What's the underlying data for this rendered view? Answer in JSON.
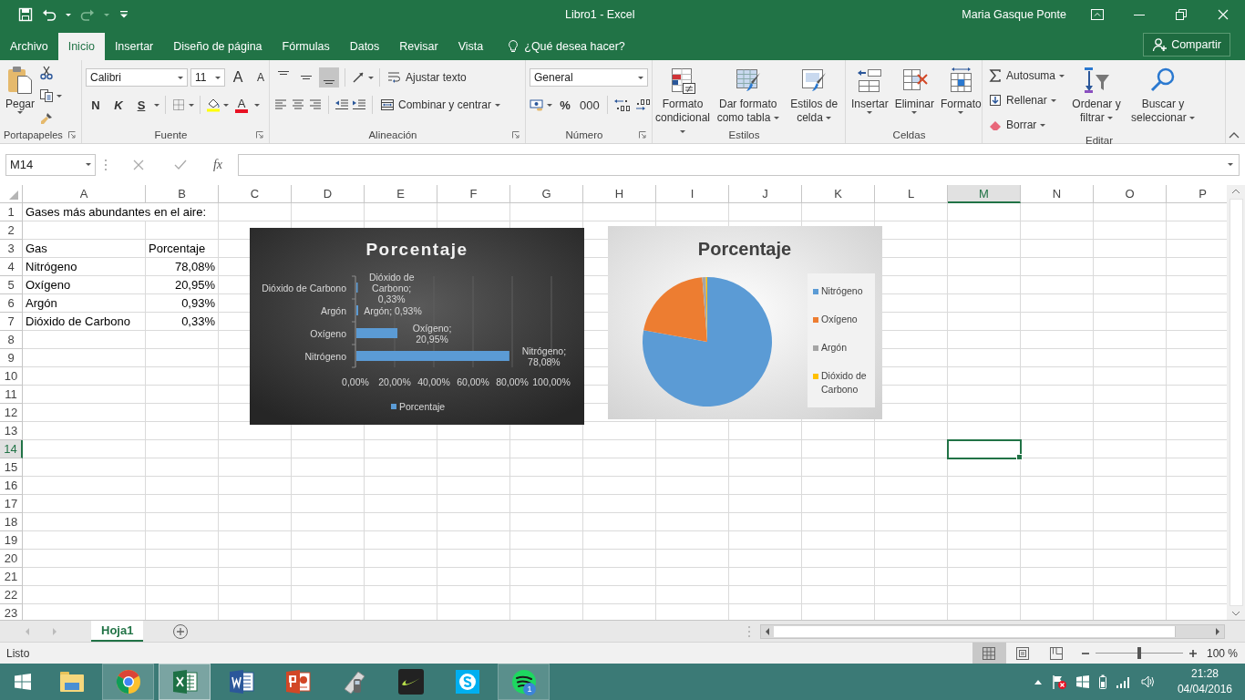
{
  "window": {
    "title": "Libro1 - Excel",
    "user": "Maria Gasque Ponte"
  },
  "tabs": [
    {
      "label": "Archivo",
      "selected": false
    },
    {
      "label": "Inicio",
      "selected": true
    },
    {
      "label": "Insertar",
      "selected": false
    },
    {
      "label": "Diseño de página",
      "selected": false
    },
    {
      "label": "Fórmulas",
      "selected": false
    },
    {
      "label": "Datos",
      "selected": false
    },
    {
      "label": "Revisar",
      "selected": false
    },
    {
      "label": "Vista",
      "selected": false
    }
  ],
  "tell_me": "¿Qué desea hacer?",
  "share": "Compartir",
  "ribbon": {
    "clipboard": {
      "label": "Portapapeles",
      "paste": "Pegar"
    },
    "font": {
      "label": "Fuente",
      "font_name": "Calibri",
      "font_size": "11",
      "grow": "A",
      "shrink": "A",
      "bold": "N",
      "italic": "K",
      "underline": "S",
      "font_color": "A"
    },
    "alignment": {
      "label": "Alineación",
      "vertical": [
        {
          "selected": false
        },
        {
          "selected": false
        },
        {
          "selected": true
        }
      ],
      "wrap": "Ajustar texto",
      "merge": "Combinar y centrar"
    },
    "number": {
      "label": "Número",
      "format": "General",
      "percent": "%",
      "thousands": "000"
    },
    "styles": {
      "label": "Estilos",
      "buttons": [
        "Formato condicional",
        "Dar formato como tabla",
        "Estilos de celda"
      ]
    },
    "cells": {
      "label": "Celdas",
      "buttons": [
        "Insertar",
        "Eliminar",
        "Formato"
      ]
    },
    "editing": {
      "label": "Editar",
      "commands": [
        "Autosuma",
        "Rellenar",
        "Borrar"
      ],
      "buttons": [
        "Ordenar y filtrar",
        "Buscar y seleccionar"
      ]
    }
  },
  "formula_bar": {
    "name_box": "M14",
    "function_label": "fx"
  },
  "sheet": {
    "columns": [
      {
        "label": "A",
        "selected": false
      },
      {
        "label": "B",
        "selected": false
      },
      {
        "label": "C",
        "selected": false
      },
      {
        "label": "D",
        "selected": false
      },
      {
        "label": "E",
        "selected": false
      },
      {
        "label": "F",
        "selected": false
      },
      {
        "label": "G",
        "selected": false
      },
      {
        "label": "H",
        "selected": false
      },
      {
        "label": "I",
        "selected": false
      },
      {
        "label": "J",
        "selected": false
      },
      {
        "label": "K",
        "selected": false
      },
      {
        "label": "L",
        "selected": false
      },
      {
        "label": "M",
        "selected": true
      },
      {
        "label": "N",
        "selected": false
      },
      {
        "label": "O",
        "selected": false
      },
      {
        "label": "P",
        "selected": false
      }
    ],
    "rows": [
      {
        "label": "1",
        "selected": false,
        "cells": {
          "A": {
            "text": "Gases más abundantes en el aire:"
          }
        }
      },
      {
        "label": "2",
        "selected": false
      },
      {
        "label": "3",
        "selected": false,
        "cells": {
          "A": {
            "text": "Gas"
          },
          "B": {
            "text": "Porcentaje"
          }
        }
      },
      {
        "label": "4",
        "selected": false,
        "cells": {
          "A": {
            "text": "Nitrógeno"
          },
          "B": {
            "text": "78,08%",
            "kind": "number"
          }
        }
      },
      {
        "label": "5",
        "selected": false,
        "cells": {
          "A": {
            "text": "Oxígeno"
          },
          "B": {
            "text": "20,95%",
            "kind": "number"
          }
        }
      },
      {
        "label": "6",
        "selected": false,
        "cells": {
          "A": {
            "text": "Argón"
          },
          "B": {
            "text": "0,93%",
            "kind": "number"
          }
        }
      },
      {
        "label": "7",
        "selected": false,
        "cells": {
          "A": {
            "text": "Dióxido de Carbono"
          },
          "B": {
            "text": "0,33%",
            "kind": "number"
          }
        }
      },
      {
        "label": "8",
        "selected": false
      },
      {
        "label": "9",
        "selected": false
      },
      {
        "label": "10",
        "selected": false
      },
      {
        "label": "11",
        "selected": false
      },
      {
        "label": "12",
        "selected": false
      },
      {
        "label": "13",
        "selected": false
      },
      {
        "label": "14",
        "selected": true
      },
      {
        "label": "15",
        "selected": false
      },
      {
        "label": "16",
        "selected": false
      },
      {
        "label": "17",
        "selected": false
      },
      {
        "label": "18",
        "selected": false
      },
      {
        "label": "19",
        "selected": false
      },
      {
        "label": "20",
        "selected": false
      },
      {
        "label": "21",
        "selected": false
      },
      {
        "label": "22",
        "selected": false
      },
      {
        "label": "23",
        "selected": false
      }
    ],
    "charts": [
      {
        "chart_data": {
          "type": "bar",
          "orientation": "horizontal",
          "title": "Porcentaje",
          "categories": [
            "Dióxido de Carbono",
            "Argón",
            "Oxígeno",
            "Nitrógeno"
          ],
          "series": [
            {
              "name": "Porcentaje",
              "color": "#5b9bd5",
              "values": [
                0.33,
                0.93,
                20.95,
                78.08
              ]
            }
          ],
          "grid": true,
          "legend": true,
          "xlim": [
            0,
            100
          ],
          "xticks": [
            {
              "value": 0,
              "label": "0,00%"
            },
            {
              "value": 20,
              "label": "20,00%"
            },
            {
              "value": 40,
              "label": "40,00%"
            },
            {
              "value": 60,
              "label": "60,00%"
            },
            {
              "value": 80,
              "label": "80,00%"
            },
            {
              "value": 100,
              "label": "100,00%"
            }
          ],
          "value_labels": [
            "Dióxido de Carbono; 0,33%",
            "Argón; 0,93%",
            "Oxígeno; 20,95%",
            "Nitrógeno; 78,08%"
          ]
        }
      },
      {
        "chart_data": {
          "type": "pie",
          "title": "Porcentaje",
          "categories": [
            "Nitrógeno",
            "Oxígeno",
            "Argón",
            "Dióxido de Carbono"
          ],
          "series": [
            {
              "values": [
                78.08,
                20.95,
                0.93,
                0.33
              ]
            }
          ],
          "legend": true,
          "colors": [
            "#5b9bd5",
            "#ed7d31",
            "#a5a5a5",
            "#ffc000"
          ]
        }
      }
    ]
  },
  "sheet_tabs": [
    {
      "label": "Hoja1",
      "selected": true
    }
  ],
  "status_bar": {
    "status": "Listo",
    "views": [
      {
        "selected": true
      },
      {
        "selected": false
      },
      {
        "selected": false
      }
    ],
    "zoom": {
      "level": 0.5
    },
    "zoom_label": "100 %"
  },
  "taskbar": {
    "apps": [
      {
        "open": false,
        "selected": false
      },
      {
        "open": true,
        "selected": false
      },
      {
        "open": true,
        "selected": true
      },
      {
        "open": false,
        "selected": false
      },
      {
        "open": false,
        "selected": false
      },
      {
        "open": false,
        "selected": false
      },
      {
        "open": false,
        "selected": false
      },
      {
        "open": false,
        "selected": false
      },
      {
        "open": true,
        "selected": false,
        "badge": "1"
      }
    ],
    "time": "21:28",
    "date": "04/04/2016"
  }
}
